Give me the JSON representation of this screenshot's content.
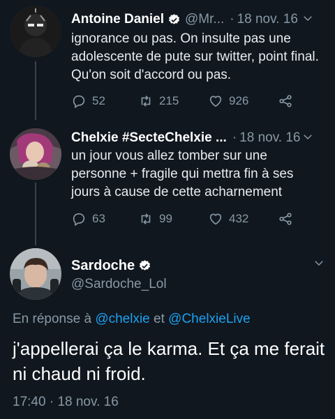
{
  "tweets": [
    {
      "name": "Antoine Daniel",
      "handle": "@Mr...",
      "separator": "·",
      "date": "18 nov. 16",
      "text": "ignorance ou pas. On insulte pas une adolescente de pute sur twitter, point final. Qu'on soit d'accord ou pas.",
      "replies": "52",
      "retweets": "215",
      "likes": "926"
    },
    {
      "name": "Chelxie #SecteChelxie ...",
      "separator": "·",
      "date": "18 nov. 16",
      "text": "un jour vous allez tomber sur une personne + fragile qui mettra fin à ses jours à cause de cette acharnement",
      "replies": "63",
      "retweets": "99",
      "likes": "432"
    }
  ],
  "main": {
    "name": "Sardoche",
    "handle": "@Sardoche_Lol",
    "reply_prefix": "En réponse à",
    "reply_user1": "@chelxie",
    "reply_and": "et",
    "reply_user2": "@ChelxieLive",
    "text": "j'appellerai ça le karma. Et ça me ferait ni chaud ni froid.",
    "time": "17:40",
    "separator": "·",
    "date": "18 nov. 16"
  },
  "colors": {
    "background": "#10171e",
    "secondary_text": "#8899a6",
    "link": "#1da1f2",
    "verified": "#ffffff"
  },
  "icons": [
    "verified-badge-icon",
    "chevron-down-icon",
    "reply-icon",
    "retweet-icon",
    "like-icon",
    "share-icon"
  ]
}
